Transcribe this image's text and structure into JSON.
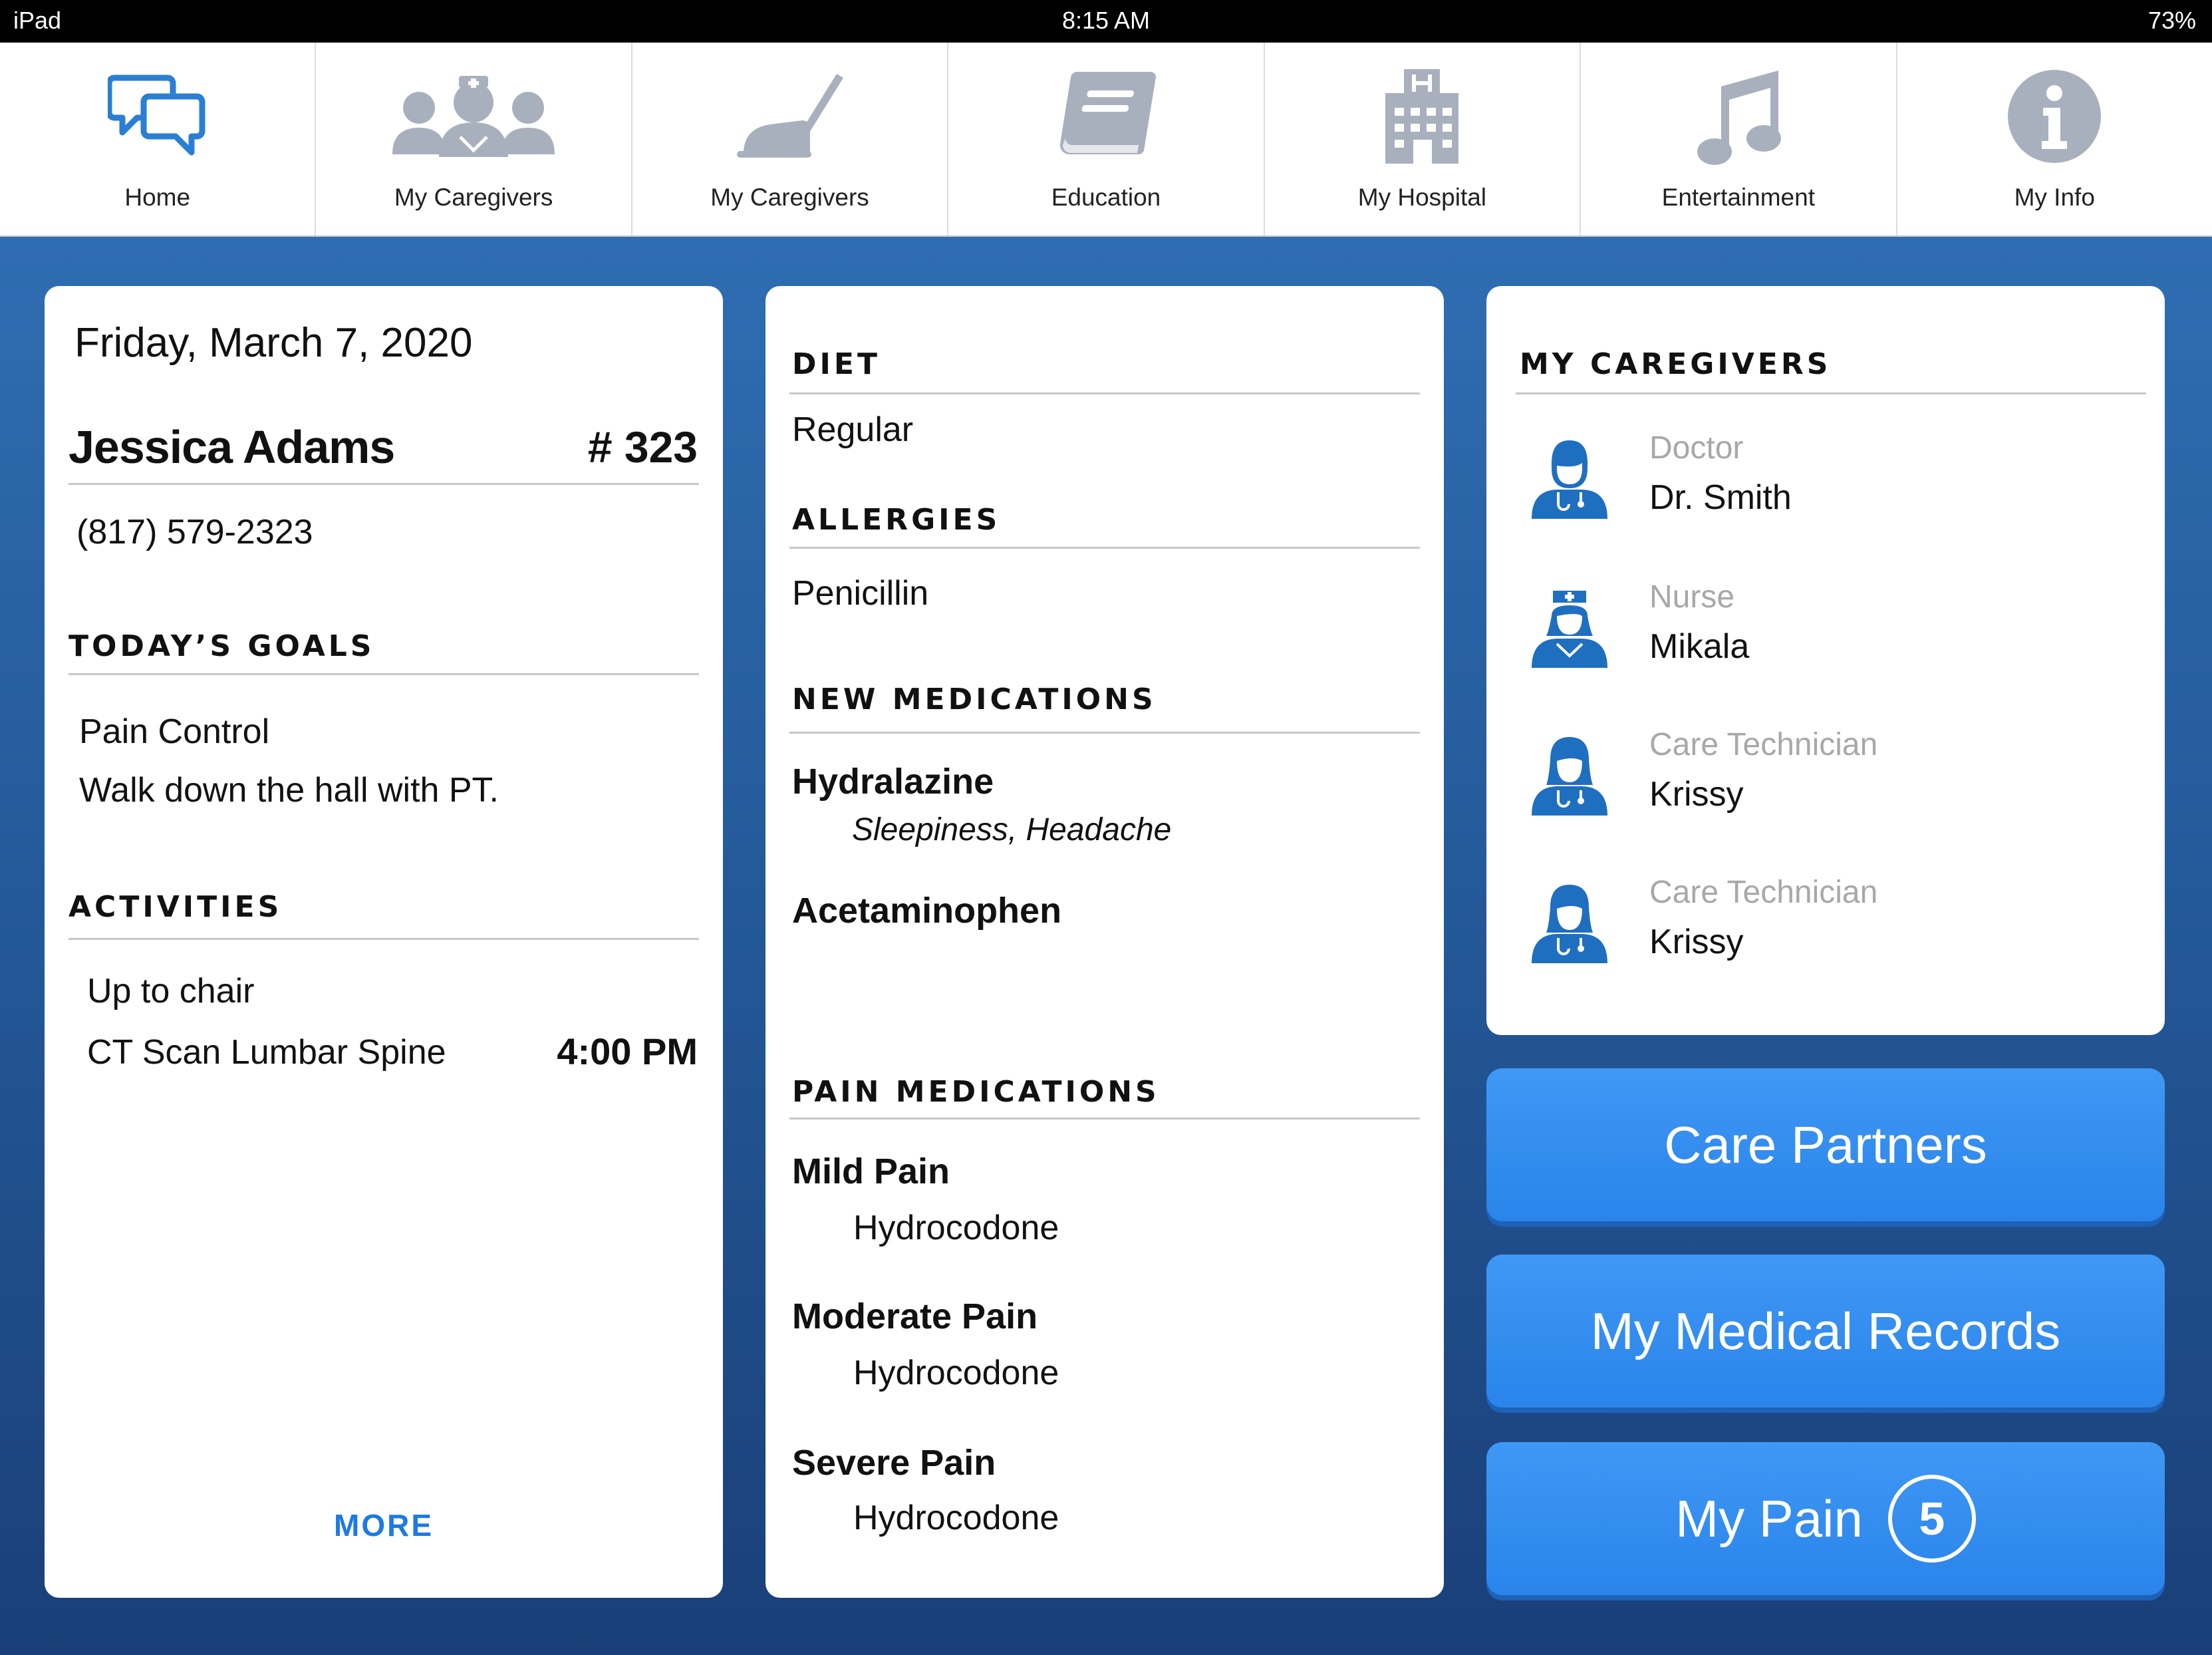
{
  "status_bar": {
    "device": "iPad",
    "time": "8:15 AM",
    "battery": "73%"
  },
  "nav": {
    "items": [
      {
        "label": "Home",
        "icon": "chat-bubbles-icon"
      },
      {
        "label": "My Caregivers",
        "icon": "care-team-icon"
      },
      {
        "label": "My Caregivers",
        "icon": "vacuum-icon"
      },
      {
        "label": "Education",
        "icon": "book-icon"
      },
      {
        "label": "My Hospital",
        "icon": "hospital-icon"
      },
      {
        "label": "Entertainment",
        "icon": "music-note-icon"
      },
      {
        "label": "My Info",
        "icon": "info-icon"
      }
    ]
  },
  "patient": {
    "date": "Friday, March 7, 2020",
    "name": "Jessica Adams",
    "room": "# 323",
    "phone": "(817) 579-2323",
    "goals_title": "TODAY’S GOALS",
    "goals": [
      "Pain Control",
      "Walk down the hall with PT."
    ],
    "activities_title": "ACTIVITIES",
    "activities": [
      {
        "name": "Up to chair",
        "time": ""
      },
      {
        "name": "CT Scan Lumbar Spine",
        "time": "4:00 PM"
      }
    ],
    "more_label": "MORE"
  },
  "medical": {
    "diet_title": "DIET",
    "diet": "Regular",
    "allergies_title": "ALLERGIES",
    "allergies": "Penicillin",
    "new_meds_title": "NEW MEDICATIONS",
    "new_meds": [
      {
        "name": "Hydralazine",
        "side_effects": "Sleepiness, Headache"
      },
      {
        "name": "Acetaminophen",
        "side_effects": ""
      }
    ],
    "pain_meds_title": "PAIN MEDICATIONS",
    "pain_meds": [
      {
        "level": "Mild Pain",
        "drug": "Hydrocodone"
      },
      {
        "level": "Moderate Pain",
        "drug": "Hydrocodone"
      },
      {
        "level": "Severe Pain",
        "drug": "Hydrocodone"
      }
    ]
  },
  "caregivers": {
    "title": "MY CAREGIVERS",
    "list": [
      {
        "role": "Doctor",
        "name": "Dr. Smith",
        "icon": "doctor-icon"
      },
      {
        "role": "Nurse",
        "name": "Mikala",
        "icon": "nurse-icon"
      },
      {
        "role": "Care Technician",
        "name": "Krissy",
        "icon": "care-technician-icon"
      },
      {
        "role": "Care Technician",
        "name": "Krissy",
        "icon": "care-technician-icon"
      }
    ]
  },
  "buttons": {
    "care_partners": "Care Partners",
    "medical_records": "My Medical Records",
    "my_pain": "My Pain",
    "pain_score": "5"
  },
  "colors": {
    "accent": "#2a84ea",
    "nav_icon_gray": "#a9b0bd",
    "home_icon_blue": "#2a7fd4",
    "caregiver_icon_blue": "#1f6fc0",
    "more_link": "#1d7ae6"
  }
}
